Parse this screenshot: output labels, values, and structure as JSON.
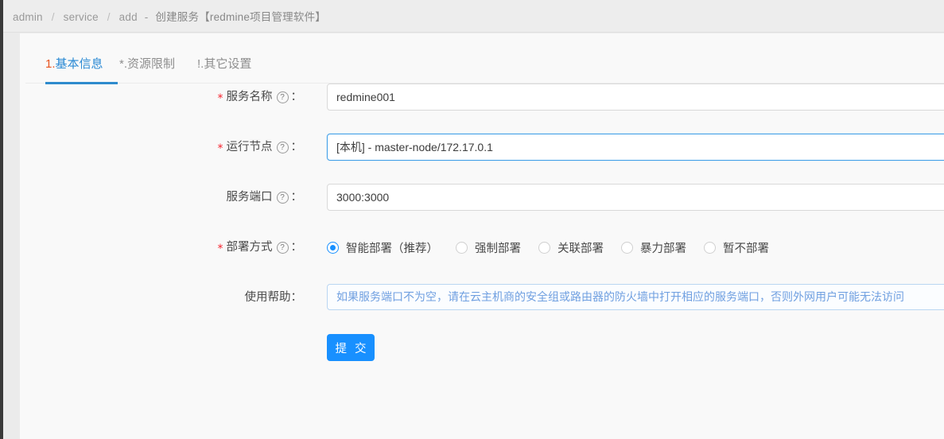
{
  "breadcrumb": {
    "item1": "admin",
    "item2": "service",
    "item3": "add",
    "separator": "/",
    "dash": "-",
    "title": "创建服务【redmine项目管理软件】"
  },
  "tabs": [
    {
      "prefix": "1.",
      "label": "基本信息",
      "active": true
    },
    {
      "prefix": "*.",
      "label": "资源限制",
      "active": false
    },
    {
      "prefix": "!.",
      "label": "其它设置",
      "active": false
    }
  ],
  "form": {
    "rows": [
      {
        "required": true,
        "label": "服务名称",
        "has_help_icon": true,
        "help_icon": "question-circle-icon",
        "colon": "：",
        "type": "text",
        "value": "redmine001",
        "placeholder": "",
        "focused": false
      },
      {
        "required": true,
        "label": "运行节点",
        "has_help_icon": true,
        "help_icon": "question-circle-icon",
        "colon": "：",
        "type": "text",
        "value": "[本机] - master-node/172.17.0.1",
        "placeholder": "",
        "focused": true
      },
      {
        "required": false,
        "label": "服务端口",
        "has_help_icon": true,
        "help_icon": "question-circle-icon",
        "colon": "：",
        "type": "text",
        "value": "3000:3000",
        "placeholder": "",
        "focused": false
      },
      {
        "required": true,
        "label": "部署方式",
        "has_help_icon": true,
        "help_icon": "question-circle-icon",
        "colon": "：",
        "type": "radio"
      },
      {
        "required": false,
        "label": "使用帮助",
        "has_help_icon": false,
        "colon": "：",
        "type": "helper",
        "value": "如果服务端口不为空，请在云主机商的安全组或路由器的防火墙中打开相应的服务端口，否则外网用户可能无法访问",
        "placeholder": "",
        "focused": false
      }
    ],
    "deploy_options": [
      {
        "label": "智能部署（推荐）",
        "checked": true
      },
      {
        "label": "强制部署",
        "checked": false
      },
      {
        "label": "关联部署",
        "checked": false
      },
      {
        "label": "暴力部署",
        "checked": false
      },
      {
        "label": "暂不部署",
        "checked": false
      }
    ],
    "submit_label": "提 交",
    "question_mark": "?",
    "required_mark": "*"
  },
  "colors": {
    "accent_blue": "#1890ff",
    "tab_active_blue": "#2b8ad4",
    "tab_prefix_red": "#e8541f",
    "required_red": "#f5222d",
    "helper_text_blue": "#6f9fe0",
    "helper_border_blue": "#b9d6f2",
    "page_bg": "#ebebeb",
    "card_bg": "#f9f9f9",
    "header_bg": "#ededed"
  }
}
